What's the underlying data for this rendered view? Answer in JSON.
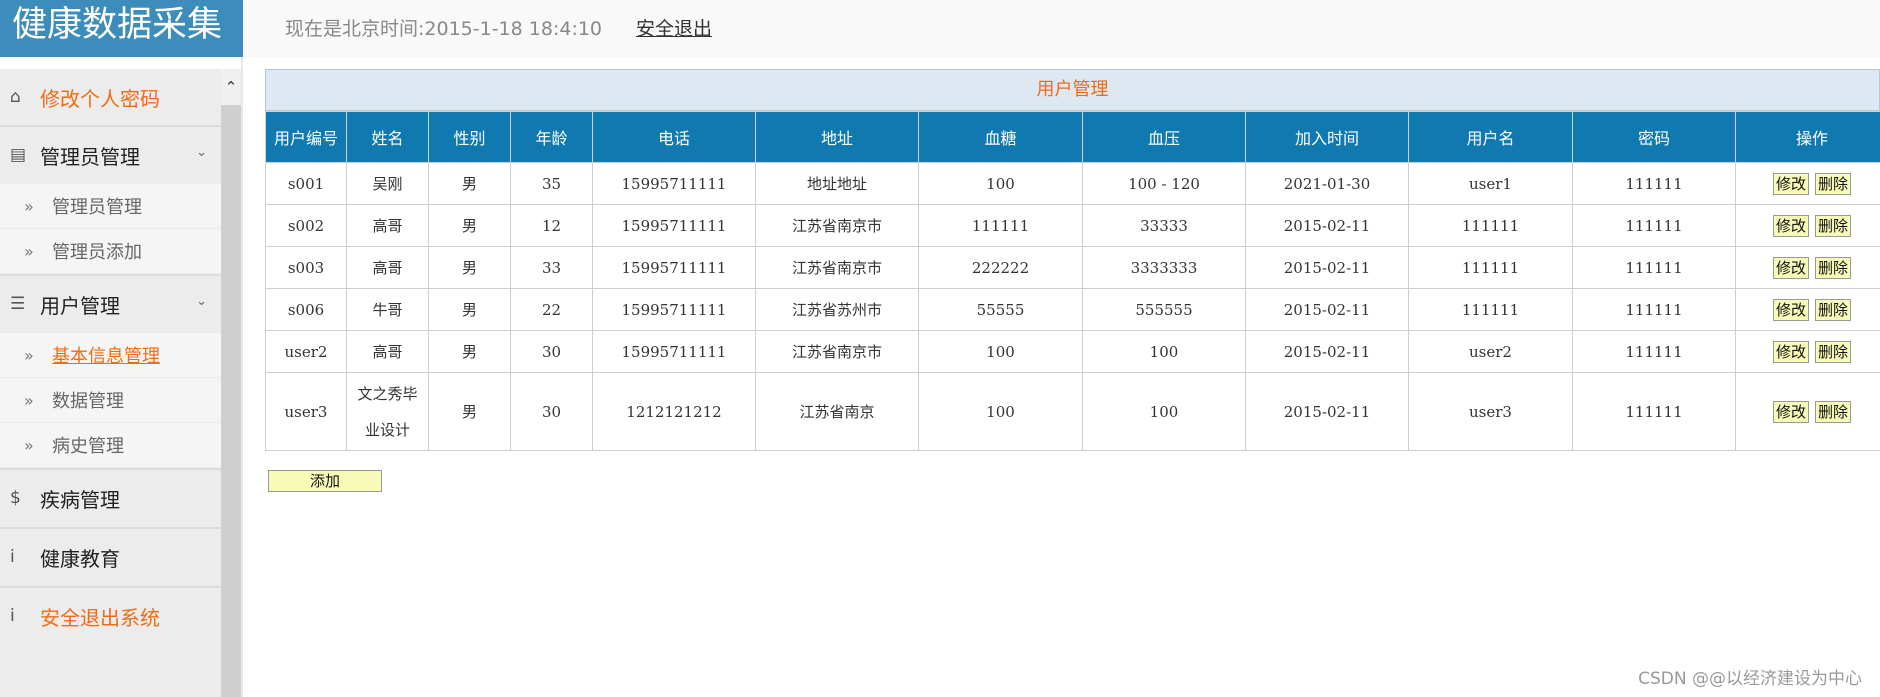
{
  "header": {
    "brand": "健康数据采集",
    "clock": "现在是北京时间:2015-1-18 18:4:10",
    "logout": "安全退出"
  },
  "sidebar": {
    "change_password": "修改个人密码",
    "admin_section": "管理员管理",
    "admin_items": [
      "管理员管理",
      "管理员添加"
    ],
    "user_section": "用户管理",
    "user_items": [
      "基本信息管理",
      "数据管理",
      "病史管理"
    ],
    "disease_section": "疾病管理",
    "education_section": "健康教育",
    "exit_section": "安全退出系统"
  },
  "panel": {
    "title": "用户管理",
    "columns": [
      "用户编号",
      "姓名",
      "性别",
      "年龄",
      "电话",
      "地址",
      "血糖",
      "血压",
      "加入时间",
      "用户名",
      "密码",
      "操作"
    ],
    "rows": [
      [
        "s001",
        "吴刚",
        "男",
        "35",
        "15995711111",
        "地址地址",
        "100",
        "100 - 120",
        "2021-01-30",
        "user1",
        "111111"
      ],
      [
        "s002",
        "高哥",
        "男",
        "12",
        "15995711111",
        "江苏省南京市",
        "111111",
        "33333",
        "2015-02-11",
        "111111",
        "111111"
      ],
      [
        "s003",
        "高哥",
        "男",
        "33",
        "15995711111",
        "江苏省南京市",
        "222222",
        "3333333",
        "2015-02-11",
        "111111",
        "111111"
      ],
      [
        "s006",
        "牛哥",
        "男",
        "22",
        "15995711111",
        "江苏省苏州市",
        "55555",
        "555555",
        "2015-02-11",
        "111111",
        "111111"
      ],
      [
        "user2",
        "高哥",
        "男",
        "30",
        "15995711111",
        "江苏省南京市",
        "100",
        "100",
        "2015-02-11",
        "user2",
        "111111"
      ],
      [
        "user3",
        "文之秀毕业设计",
        "男",
        "30",
        "1212121212",
        "江苏省南京",
        "100",
        "100",
        "2015-02-11",
        "user3",
        "111111"
      ]
    ],
    "edit_label": "修改",
    "delete_label": "删除",
    "add_label": "添加"
  },
  "watermark": "CSDN @@以经济建设为中心",
  "colors": {
    "brand_bg": "#3c8dbc",
    "table_header_bg": "#0f79b0",
    "accent_orange": "#f26b12",
    "button_bg": "#f8fbb8"
  }
}
